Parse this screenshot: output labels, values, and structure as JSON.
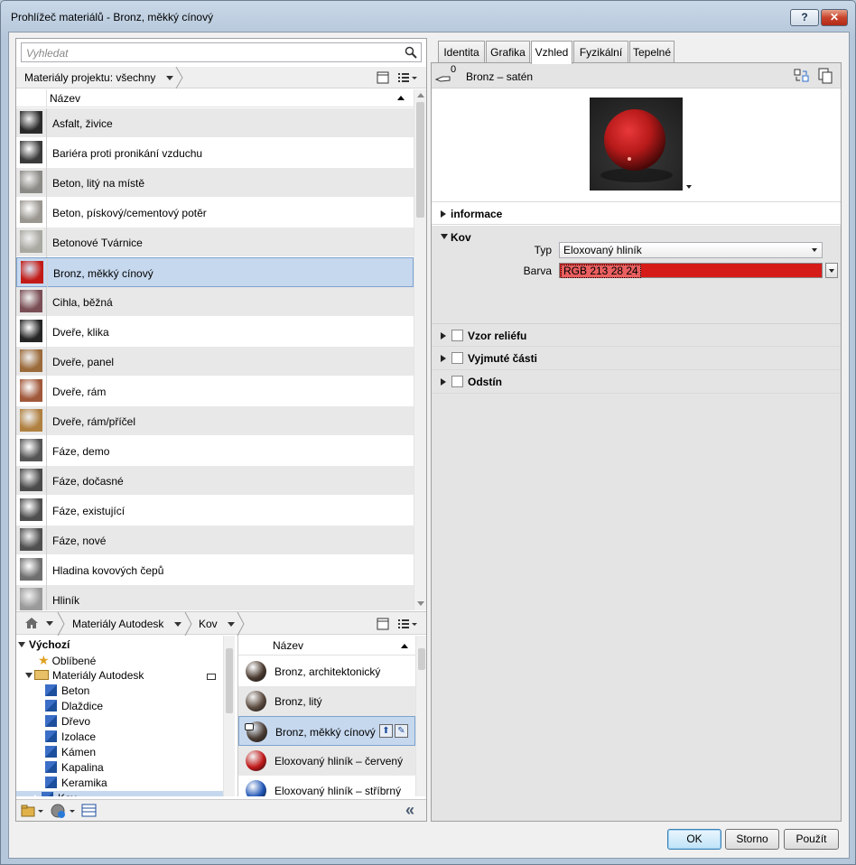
{
  "window": {
    "title": "Prohlížeč materiálů - Bronz, měkký cínový",
    "help_label": "?",
    "close_label": "✕"
  },
  "search": {
    "placeholder": "Vyhledat"
  },
  "project": {
    "filter_label": "Materiály projektu: všechny",
    "column_name": "Název",
    "materials": [
      {
        "label": "Asfalt, živice",
        "color": "#2a2a2a"
      },
      {
        "label": "Bariéra proti pronikání vzduchu",
        "color": "#3a3a3a"
      },
      {
        "label": "Beton, litý na místě",
        "color": "#8c8a86"
      },
      {
        "label": "Beton, pískový/cementový potěr",
        "color": "#9a9690"
      },
      {
        "label": "Betonové Tvárnice",
        "color": "#a9a8a1"
      },
      {
        "label": "Bronz, měkký cínový",
        "color": "#c21a16"
      },
      {
        "label": "Cihla, běžná",
        "color": "#7a4e55"
      },
      {
        "label": "Dveře, klika",
        "color": "#262626"
      },
      {
        "label": "Dveře, panel",
        "color": "#9b6a3a"
      },
      {
        "label": "Dveře, rám",
        "color": "#a0583a"
      },
      {
        "label": "Dveře, rám/příčel",
        "color": "#b08040"
      },
      {
        "label": "Fáze, demo",
        "color": "#555555"
      },
      {
        "label": "Fáze, dočasné",
        "color": "#4a4a4a"
      },
      {
        "label": "Fáze, existující",
        "color": "#4e4e4e"
      },
      {
        "label": "Fáze, nové",
        "color": "#505050"
      },
      {
        "label": "Hladina kovových čepů",
        "color": "#6f6f6f"
      },
      {
        "label": "Hliník",
        "color": "#9a9a9a"
      }
    ]
  },
  "library": {
    "home_label": "⌂",
    "crumb1": "Materiály Autodesk",
    "crumb2": "Kov",
    "column_name": "Název",
    "tree": [
      {
        "label": "Výchozí",
        "level": 0,
        "bold": true
      },
      {
        "label": "Oblíbené",
        "level": 1
      },
      {
        "label": "Materiály Autodesk",
        "level": 1
      },
      {
        "label": "Beton",
        "level": 2
      },
      {
        "label": "Dlaždice",
        "level": 2
      },
      {
        "label": "Dřevo",
        "level": 2
      },
      {
        "label": "Izolace",
        "level": 2
      },
      {
        "label": "Kámen",
        "level": 2
      },
      {
        "label": "Kapalina",
        "level": 2
      },
      {
        "label": "Keramika",
        "level": 2
      },
      {
        "label": "Kov",
        "level": 2
      }
    ],
    "items": [
      {
        "label": "Bronz, architektonický",
        "color": "#4a3a30"
      },
      {
        "label": "Bronz, litý",
        "color": "#5b4a3e"
      },
      {
        "label": "Bronz, měkký cínový",
        "color": "#4a3c34"
      },
      {
        "label": "Eloxovaný hliník – červený",
        "color": "#c01818"
      },
      {
        "label": "Eloxovaný hliník – stříbrný",
        "color": "#1f55b5"
      }
    ],
    "collapse_label": "«"
  },
  "tabs": [
    {
      "label": "Identita"
    },
    {
      "label": "Grafika"
    },
    {
      "label": "Vzhled"
    },
    {
      "label": "Fyzikální"
    },
    {
      "label": "Tepelné"
    }
  ],
  "appearance": {
    "hand_count": "0",
    "asset_name": "Bronz – satén",
    "sections": {
      "info": "informace",
      "metal": "Kov",
      "relief": "Vzor reliéfu",
      "cutouts": "Vyjmuté části",
      "tint": "Odstín"
    },
    "type_label": "Typ",
    "type_value": "Eloxovaný hliník",
    "color_label": "Barva",
    "color_value": "RGB 213 28 24",
    "color_hex": "#d51c18"
  },
  "buttons": {
    "ok": "OK",
    "cancel": "Storno",
    "apply": "Použít"
  }
}
